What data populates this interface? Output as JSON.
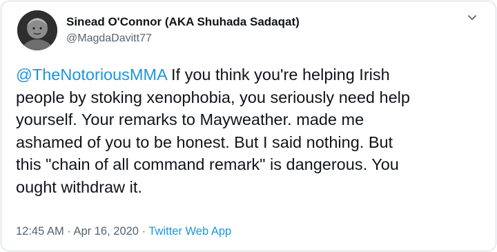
{
  "tweet": {
    "author": {
      "display_name": "Sinead O'Connor (AKA Shuhada Sadaqat)",
      "handle": "@MagdaDavitt77",
      "avatar_icon": "profile-photo"
    },
    "more_icon": "chevron-down-icon",
    "mention": "@TheNotoriousMMA",
    "body_lines": [
      " If you think you're helping Irish",
      "people by stoking xenophobia, you seriously need help",
      "yourself. Your remarks to Mayweather. made me",
      "ashamed of you to be honest. But I said nothing. But",
      "this \"chain of all command remark\" is dangerous. You",
      "ought withdraw it."
    ],
    "time": "12:45 AM",
    "separator1": " · ",
    "date": "Apr 16, 2020",
    "separator2": " · ",
    "source": "Twitter Web App"
  },
  "colors": {
    "link": "#1b95e0",
    "text": "#0f1419",
    "secondary": "#536471",
    "border": "#cfd9de"
  }
}
